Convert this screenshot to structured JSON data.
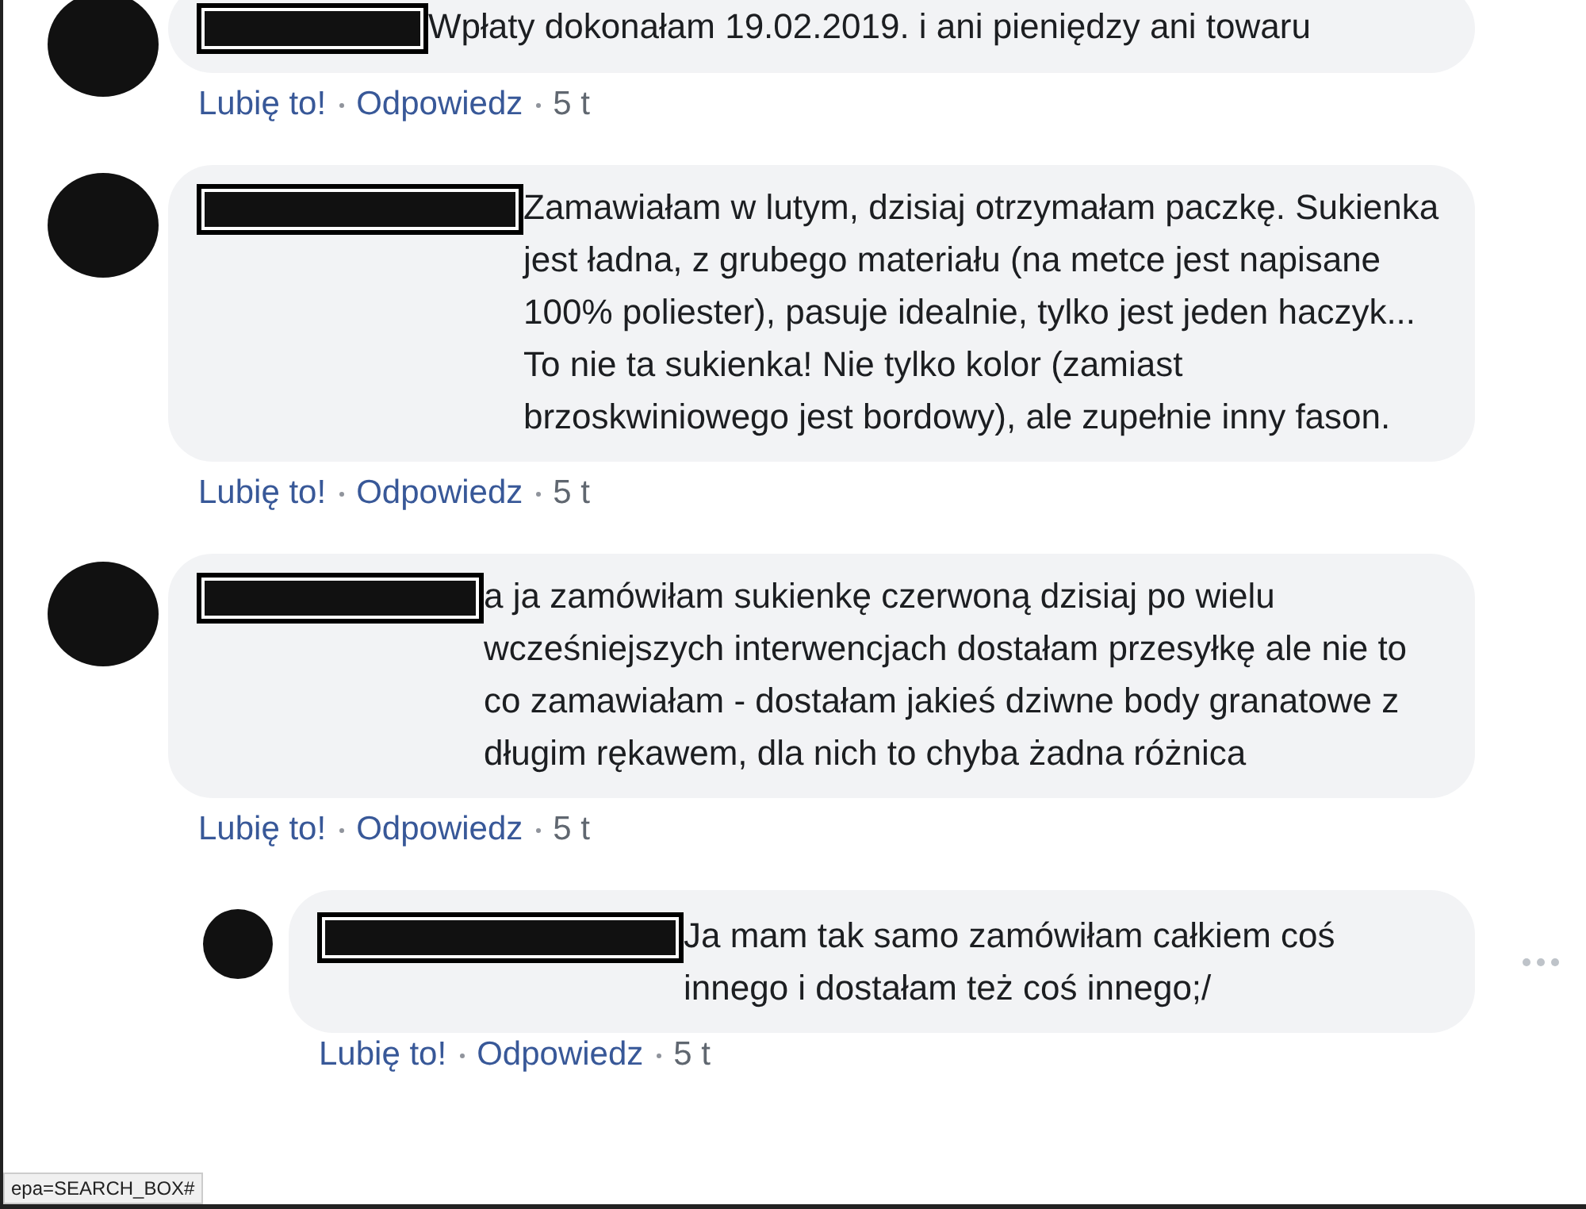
{
  "comments": [
    {
      "kind": "comment",
      "text": "Wpłaty dokonałam 19.02.2019. i ani pieniędzy ani towaru",
      "like": "Lubię to!",
      "reply": "Odpowiedz",
      "time": "5 t"
    },
    {
      "kind": "comment",
      "text": "Zamawiałam w lutym, dzisiaj otrzymałam paczkę. Sukienka jest ładna, z grubego materiału (na metce jest napisane 100% poliester), pasuje idealnie, tylko jest jeden haczyk... To nie ta sukienka! Nie tylko kolor (zamiast brzoskwiniowego jest bordowy), ale zupełnie inny fason.",
      "like": "Lubię to!",
      "reply": "Odpowiedz",
      "time": "5 t"
    },
    {
      "kind": "comment",
      "text": "a ja zamówiłam sukienkę czerwoną dzisiaj po wielu wcześniejszych interwencjach dostałam przesyłkę ale nie to co zamawiałam - dostałam jakieś dziwne body granatowe z długim rękawem, dla nich to chyba żadna różnica",
      "like": "Lubię to!",
      "reply": "Odpowiedz",
      "time": "5 t"
    },
    {
      "kind": "reply",
      "text": "Ja mam tak samo zamówiłam całkiem coś innego i dostałam też coś innego;/",
      "like": "Lubię to!",
      "reply": "Odpowiedz",
      "time": "5 t"
    }
  ],
  "status_bar": {
    "text": "epa=SEARCH_BOX#"
  }
}
